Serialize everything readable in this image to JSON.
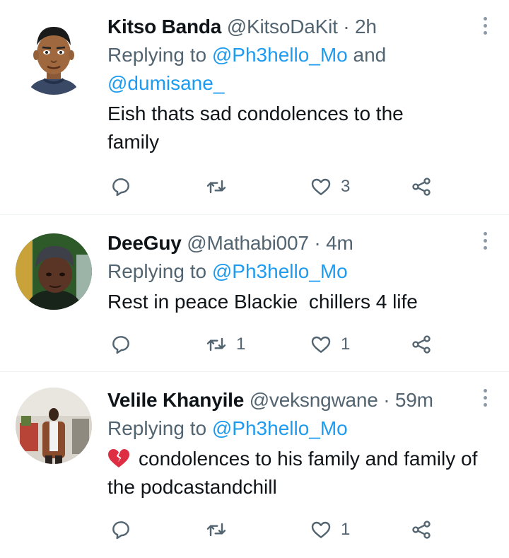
{
  "tweets": [
    {
      "name": "Kitso Banda",
      "handle": "@KitsoDaKit",
      "separator": "·",
      "time": "2h",
      "replying_prefix": "Replying to ",
      "mentions": [
        "@Ph3hello_Mo",
        "@dumisane_"
      ],
      "mention_joiner": " and ",
      "text": "Eish thats sad condolences to the family",
      "reply_count": "",
      "retweet_count": "",
      "like_count": "3"
    },
    {
      "name": "DeeGuy",
      "handle": "@Mathabi007",
      "separator": "·",
      "time": "4m",
      "replying_prefix": "Replying to ",
      "mentions": [
        "@Ph3hello_Mo"
      ],
      "text": "Rest in peace Blackie  chillers 4 life",
      "reply_count": "",
      "retweet_count": "1",
      "like_count": "1"
    },
    {
      "name": "Velile Khanyile",
      "handle": "@veksngwane",
      "separator": "·",
      "time": "59m",
      "replying_prefix": "Replying to ",
      "mentions": [
        "@Ph3hello_Mo"
      ],
      "text_emoji": "broken-heart-emoji",
      "text": "condolences to his family and family of the podcastandchill",
      "reply_count": "",
      "retweet_count": "",
      "like_count": "1"
    }
  ],
  "icons": {
    "reply": "reply-icon",
    "retweet": "retweet-icon",
    "like": "heart-icon",
    "share": "share-icon",
    "more": "more-options-icon"
  },
  "colors": {
    "mention": "#1d9bf0",
    "secondary_text": "#536471",
    "divider": "#eff3f4"
  }
}
